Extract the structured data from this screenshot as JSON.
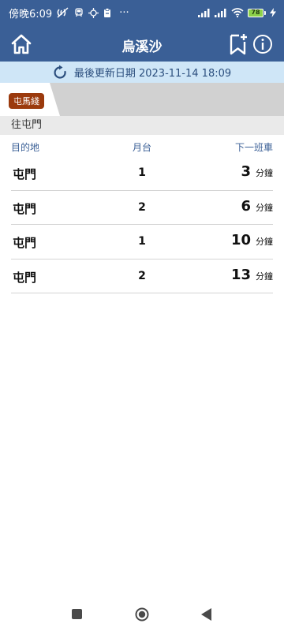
{
  "status_bar": {
    "time": "傍晚6:09",
    "more": "···",
    "battery": "78"
  },
  "app_bar": {
    "title": "烏溪沙"
  },
  "update": {
    "text": "最後更新日期 2023-11-14 18:09"
  },
  "line": {
    "name": "屯馬綫",
    "color": "#9b3a0d"
  },
  "direction": "往屯門",
  "columns": {
    "destination": "目的地",
    "platform": "月台",
    "next_train": "下一班車"
  },
  "trains": [
    {
      "dest": "屯門",
      "platform": "1",
      "minutes": "3",
      "unit": "分鐘"
    },
    {
      "dest": "屯門",
      "platform": "2",
      "minutes": "6",
      "unit": "分鐘"
    },
    {
      "dest": "屯門",
      "platform": "1",
      "minutes": "10",
      "unit": "分鐘"
    },
    {
      "dest": "屯門",
      "platform": "2",
      "minutes": "13",
      "unit": "分鐘"
    }
  ],
  "colors": {
    "header": "#3a5f96",
    "update_bar": "#cfe6f7",
    "tab_bar": "#d1d1d1"
  },
  "icons": {
    "home": "home-icon",
    "bookmark_add": "bookmark-add-icon",
    "info": "info-icon",
    "refresh": "refresh-icon"
  }
}
